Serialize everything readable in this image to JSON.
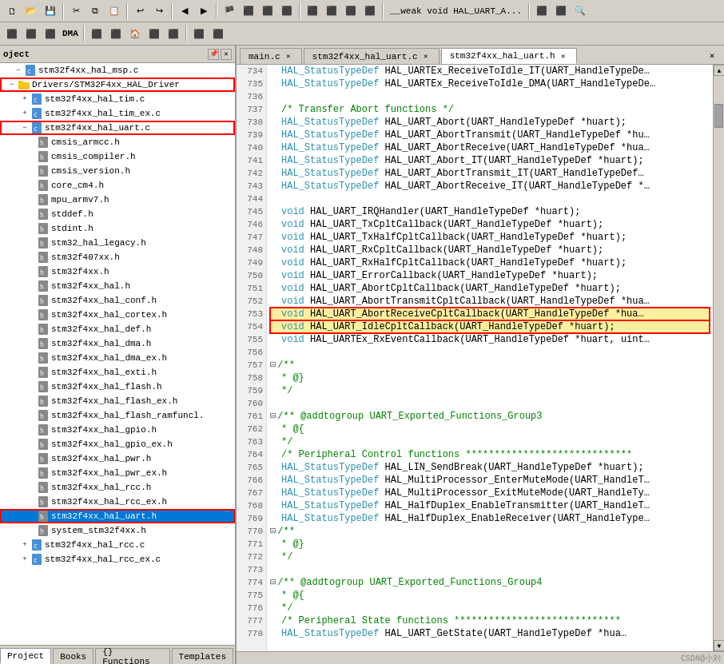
{
  "toolbar": {
    "dma_label": "DMA",
    "row1_buttons": [
      "⬛",
      "⬛",
      "⬛",
      "⬛",
      "⬛",
      "⬛",
      "⬛",
      "⬛",
      "⬛",
      "⬛",
      "⬛",
      "⬛",
      "⬛"
    ],
    "row2_buttons": [
      "⬛",
      "⬛",
      "⬛",
      "⬛",
      "⬛",
      "⬛",
      "⬛",
      "⬛",
      "⬛",
      "⬛",
      "⬛"
    ]
  },
  "left_panel": {
    "title": "oject",
    "tree_items": [
      {
        "indent": 16,
        "toggle": "⊟",
        "icon": "📄",
        "type": "file-c",
        "label": "stm32f4xx_hal_msp.c",
        "highlighted": false
      },
      {
        "indent": 8,
        "toggle": "⊟",
        "icon": "📁",
        "type": "folder",
        "label": "Drivers/STM32F4xx_HAL_Driver",
        "highlighted": true
      },
      {
        "indent": 24,
        "toggle": "⊞",
        "icon": "📄",
        "type": "file-c",
        "label": "stm32f4xx_hal_tim.c",
        "highlighted": false
      },
      {
        "indent": 24,
        "toggle": "⊞",
        "icon": "📄",
        "type": "file-c",
        "label": "stm32f4xx_hal_tim_ex.c",
        "highlighted": false
      },
      {
        "indent": 24,
        "toggle": "—",
        "icon": "📄",
        "type": "file-c",
        "label": "stm32f4xx_hal_uart.c",
        "highlighted": true
      },
      {
        "indent": 32,
        "toggle": " ",
        "icon": "📄",
        "type": "file-h",
        "label": "cmsis_armcc.h",
        "highlighted": false
      },
      {
        "indent": 32,
        "toggle": " ",
        "icon": "📄",
        "type": "file-h",
        "label": "cmsis_compiler.h",
        "highlighted": false
      },
      {
        "indent": 32,
        "toggle": " ",
        "icon": "📄",
        "type": "file-h",
        "label": "cmsis_version.h",
        "highlighted": false
      },
      {
        "indent": 32,
        "toggle": " ",
        "icon": "📄",
        "type": "file-h",
        "label": "core_cm4.h",
        "highlighted": false
      },
      {
        "indent": 32,
        "toggle": " ",
        "icon": "📄",
        "type": "file-h",
        "label": "mpu_armv7.h",
        "highlighted": false
      },
      {
        "indent": 32,
        "toggle": " ",
        "icon": "📄",
        "type": "file-h",
        "label": "stddef.h",
        "highlighted": false
      },
      {
        "indent": 32,
        "toggle": " ",
        "icon": "📄",
        "type": "file-h",
        "label": "stdint.h",
        "highlighted": false
      },
      {
        "indent": 32,
        "toggle": " ",
        "icon": "📄",
        "type": "file-h",
        "label": "stm32_hal_legacy.h",
        "highlighted": false
      },
      {
        "indent": 32,
        "toggle": " ",
        "icon": "📄",
        "type": "file-h",
        "label": "stm32f407xx.h",
        "highlighted": false
      },
      {
        "indent": 32,
        "toggle": " ",
        "icon": "📄",
        "type": "file-h",
        "label": "stm32f4xx.h",
        "highlighted": false
      },
      {
        "indent": 32,
        "toggle": " ",
        "icon": "📄",
        "type": "file-h",
        "label": "stm32f4xx_hal.h",
        "highlighted": false
      },
      {
        "indent": 32,
        "toggle": " ",
        "icon": "📄",
        "type": "file-h",
        "label": "stm32f4xx_hal_conf.h",
        "highlighted": false
      },
      {
        "indent": 32,
        "toggle": " ",
        "icon": "📄",
        "type": "file-h",
        "label": "stm32f4xx_hal_cortex.h",
        "highlighted": false
      },
      {
        "indent": 32,
        "toggle": " ",
        "icon": "📄",
        "type": "file-h",
        "label": "stm32f4xx_hal_def.h",
        "highlighted": false
      },
      {
        "indent": 32,
        "toggle": " ",
        "icon": "📄",
        "type": "file-h",
        "label": "stm32f4xx_hal_dma.h",
        "highlighted": false
      },
      {
        "indent": 32,
        "toggle": " ",
        "icon": "📄",
        "type": "file-h",
        "label": "stm32f4xx_hal_dma_ex.h",
        "highlighted": false
      },
      {
        "indent": 32,
        "toggle": " ",
        "icon": "📄",
        "type": "file-h",
        "label": "stm32f4xx_hal_exti.h",
        "highlighted": false
      },
      {
        "indent": 32,
        "toggle": " ",
        "icon": "📄",
        "type": "file-h",
        "label": "stm32f4xx_hal_flash.h",
        "highlighted": false
      },
      {
        "indent": 32,
        "toggle": " ",
        "icon": "📄",
        "type": "file-h",
        "label": "stm32f4xx_hal_flash_ex.h",
        "highlighted": false
      },
      {
        "indent": 32,
        "toggle": " ",
        "icon": "📄",
        "type": "file-h",
        "label": "stm32f4xx_hal_flash_ramfuncl.",
        "highlighted": false
      },
      {
        "indent": 32,
        "toggle": " ",
        "icon": "📄",
        "type": "file-h",
        "label": "stm32f4xx_hal_gpio.h",
        "highlighted": false
      },
      {
        "indent": 32,
        "toggle": " ",
        "icon": "📄",
        "type": "file-h",
        "label": "stm32f4xx_hal_gpio_ex.h",
        "highlighted": false
      },
      {
        "indent": 32,
        "toggle": " ",
        "icon": "📄",
        "type": "file-h",
        "label": "stm32f4xx_hal_pwr.h",
        "highlighted": false
      },
      {
        "indent": 32,
        "toggle": " ",
        "icon": "📄",
        "type": "file-h",
        "label": "stm32f4xx_hal_pwr_ex.h",
        "highlighted": false
      },
      {
        "indent": 32,
        "toggle": " ",
        "icon": "📄",
        "type": "file-h",
        "label": "stm32f4xx_hal_rcc.h",
        "highlighted": false
      },
      {
        "indent": 32,
        "toggle": " ",
        "icon": "📄",
        "type": "file-h",
        "label": "stm32f4xx_hal_rcc_ex.h",
        "highlighted": false
      },
      {
        "indent": 32,
        "toggle": " ",
        "icon": "📄",
        "type": "file-h",
        "label": "stm32f4xx_hal_uart.h",
        "highlighted": true,
        "selected": true
      },
      {
        "indent": 32,
        "toggle": " ",
        "icon": "📄",
        "type": "file-h",
        "label": "system_stm32f4xx.h",
        "highlighted": false
      },
      {
        "indent": 24,
        "toggle": "⊞",
        "icon": "📄",
        "type": "file-c",
        "label": "stm32f4xx_hal_rcc.c",
        "highlighted": false
      },
      {
        "indent": 24,
        "toggle": "⊞",
        "icon": "📄",
        "type": "file-c",
        "label": "stm32f4xx_hal_rcc_ex.c",
        "highlighted": false
      }
    ],
    "bottom_tabs": [
      {
        "label": "Project",
        "active": true
      },
      {
        "label": "Books",
        "active": false
      },
      {
        "label": "{} Functions",
        "active": false
      },
      {
        "label": "Templates",
        "active": false
      }
    ]
  },
  "editor": {
    "tabs": [
      {
        "label": "main.c",
        "active": false
      },
      {
        "label": "stm32f4xx_hal_uart.c",
        "active": false
      },
      {
        "label": "stm32f4xx_hal_uart.h",
        "active": true
      }
    ],
    "lines": [
      {
        "num": 734,
        "text": "HAL_StatusTypeDef HAL_UARTEx_ReceiveToIdle_IT(UART_HandleTypeDe…",
        "highlight": false,
        "fold": false
      },
      {
        "num": 735,
        "text": "HAL_StatusTypeDef HAL_UARTEx_ReceiveToIdle_DMA(UART_HandleTypeDe…",
        "highlight": false,
        "fold": false
      },
      {
        "num": 736,
        "text": "",
        "highlight": false,
        "fold": false
      },
      {
        "num": 737,
        "text": "/* Transfer Abort functions */",
        "highlight": false,
        "fold": false,
        "comment": true
      },
      {
        "num": 738,
        "text": "HAL_StatusTypeDef HAL_UART_Abort(UART_HandleTypeDef *huart);",
        "highlight": false,
        "fold": false
      },
      {
        "num": 739,
        "text": "HAL_StatusTypeDef HAL_UART_AbortTransmit(UART_HandleTypeDef *hu…",
        "highlight": false,
        "fold": false
      },
      {
        "num": 740,
        "text": "HAL_StatusTypeDef HAL_UART_AbortReceive(UART_HandleTypeDef *hua…",
        "highlight": false,
        "fold": false
      },
      {
        "num": 741,
        "text": "HAL_StatusTypeDef HAL_UART_Abort_IT(UART_HandleTypeDef *huart);",
        "highlight": false,
        "fold": false
      },
      {
        "num": 742,
        "text": "HAL_StatusTypeDef HAL_UART_AbortTransmit_IT(UART_HandleTypeDef…",
        "highlight": false,
        "fold": false
      },
      {
        "num": 743,
        "text": "HAL_StatusTypeDef HAL_UART_AbortReceive_IT(UART_HandleTypeDef *…",
        "highlight": false,
        "fold": false
      },
      {
        "num": 744,
        "text": "",
        "highlight": false,
        "fold": false
      },
      {
        "num": 745,
        "text": "void HAL_UART_IRQHandler(UART_HandleTypeDef *huart);",
        "highlight": false,
        "fold": false
      },
      {
        "num": 746,
        "text": "void HAL_UART_TxCpltCallback(UART_HandleTypeDef *huart);",
        "highlight": false,
        "fold": false
      },
      {
        "num": 747,
        "text": "void HAL_UART_TxHalfCpltCallback(UART_HandleTypeDef *huart);",
        "highlight": false,
        "fold": false
      },
      {
        "num": 748,
        "text": "void HAL_UART_RxCpltCallback(UART_HandleTypeDef *huart);",
        "highlight": false,
        "fold": false
      },
      {
        "num": 749,
        "text": "void HAL_UART_RxHalfCpltCallback(UART_HandleTypeDef *huart);",
        "highlight": false,
        "fold": false
      },
      {
        "num": 750,
        "text": "void HAL_UART_ErrorCallback(UART_HandleTypeDef *huart);",
        "highlight": false,
        "fold": false
      },
      {
        "num": 751,
        "text": "void HAL_UART_AbortCpltCallback(UART_HandleTypeDef *huart);",
        "highlight": false,
        "fold": false
      },
      {
        "num": 752,
        "text": "void HAL_UART_AbortTransmitCpltCallback(UART_HandleTypeDef *hua…",
        "highlight": false,
        "fold": false
      },
      {
        "num": 753,
        "text": "void HAL_UART_AbortReceiveCpltCallback(UART_HandleTypeDef *hua…",
        "highlight": true,
        "fold": false
      },
      {
        "num": 754,
        "text": "void HAL_UART_IdleCpltCallback(UART_HandleTypeDef *huart);",
        "highlight": true,
        "fold": false
      },
      {
        "num": 755,
        "text": "void HAL_UARTEx_RxEventCallback(UART_HandleTypeDef *huart, uint…",
        "highlight": false,
        "fold": false
      },
      {
        "num": 756,
        "text": "",
        "highlight": false,
        "fold": false
      },
      {
        "num": 757,
        "text": "/**",
        "highlight": false,
        "fold": true,
        "comment": true
      },
      {
        "num": 758,
        "text": "  * @}",
        "highlight": false,
        "fold": false,
        "comment": true
      },
      {
        "num": 759,
        "text": "  */",
        "highlight": false,
        "fold": false,
        "comment": true
      },
      {
        "num": 760,
        "text": "",
        "highlight": false,
        "fold": false
      },
      {
        "num": 761,
        "text": "/** @addtogroup UART_Exported_Functions_Group3",
        "highlight": false,
        "fold": true,
        "comment": true
      },
      {
        "num": 762,
        "text": "  * @{",
        "highlight": false,
        "fold": false,
        "comment": true
      },
      {
        "num": 763,
        "text": "  */",
        "highlight": false,
        "fold": false,
        "comment": true
      },
      {
        "num": 764,
        "text": "/* Peripheral Control functions  *****************************",
        "highlight": false,
        "fold": false,
        "comment": true
      },
      {
        "num": 765,
        "text": "HAL_StatusTypeDef HAL_LIN_SendBreak(UART_HandleTypeDef *huart);",
        "highlight": false,
        "fold": false
      },
      {
        "num": 766,
        "text": "HAL_StatusTypeDef HAL_MultiProcessor_EnterMuteMode(UART_HandleT…",
        "highlight": false,
        "fold": false
      },
      {
        "num": 767,
        "text": "HAL_StatusTypeDef HAL_MultiProcessor_ExitMuteMode(UART_HandleTy…",
        "highlight": false,
        "fold": false
      },
      {
        "num": 768,
        "text": "HAL_StatusTypeDef HAL_HalfDuplex_EnableTransmitter(UART_HandleT…",
        "highlight": false,
        "fold": false
      },
      {
        "num": 769,
        "text": "HAL_StatusTypeDef HAL_HalfDuplex_EnableReceiver(UART_HandleType…",
        "highlight": false,
        "fold": false
      },
      {
        "num": 770,
        "text": "/**",
        "highlight": false,
        "fold": true,
        "comment": true
      },
      {
        "num": 771,
        "text": "  * @}",
        "highlight": false,
        "fold": false,
        "comment": true
      },
      {
        "num": 772,
        "text": "  */",
        "highlight": false,
        "fold": false,
        "comment": true
      },
      {
        "num": 773,
        "text": "",
        "highlight": false,
        "fold": false
      },
      {
        "num": 774,
        "text": "/** @addtogroup UART_Exported_Functions_Group4",
        "highlight": false,
        "fold": true,
        "comment": true
      },
      {
        "num": 775,
        "text": "  * @{",
        "highlight": false,
        "fold": false,
        "comment": true
      },
      {
        "num": 776,
        "text": "  */",
        "highlight": false,
        "fold": false,
        "comment": true
      },
      {
        "num": 777,
        "text": "/* Peripheral State functions  *****************************",
        "highlight": false,
        "fold": false,
        "comment": true
      },
      {
        "num": 778,
        "text": "HAL_StatusTypeDef HAL_UART_GetState(UART_HandleTypeDef *hua…",
        "highlight": false,
        "fold": false
      }
    ]
  },
  "watermark": "CSDN@小刘"
}
